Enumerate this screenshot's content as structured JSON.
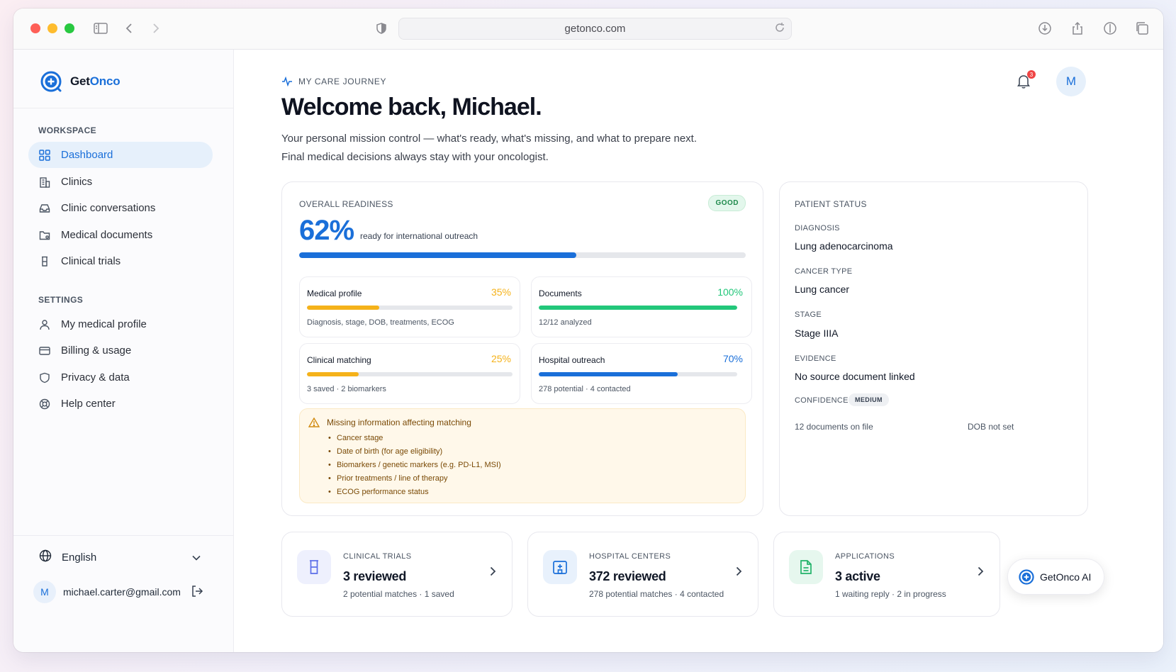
{
  "browser": {
    "url": "getonco.com"
  },
  "brand": {
    "name_part1": "Get",
    "name_part2": "Onco"
  },
  "sidebar": {
    "workspace_label": "WORKSPACE",
    "settings_label": "SETTINGS",
    "workspace_items": [
      {
        "label": "Dashboard",
        "icon": "grid-icon",
        "active": true
      },
      {
        "label": "Clinics",
        "icon": "building-icon"
      },
      {
        "label": "Clinic conversations",
        "icon": "inbox-icon"
      },
      {
        "label": "Medical documents",
        "icon": "folder-icon"
      },
      {
        "label": "Clinical trials",
        "icon": "flask-icon"
      }
    ],
    "settings_items": [
      {
        "label": "My medical profile",
        "icon": "user-icon"
      },
      {
        "label": "Billing & usage",
        "icon": "credit-card-icon"
      },
      {
        "label": "Privacy & data",
        "icon": "shield-icon"
      },
      {
        "label": "Help center",
        "icon": "lifebuoy-icon"
      }
    ],
    "language": "English",
    "user_initial": "M",
    "user_email": "michael.carter@gmail.com"
  },
  "header": {
    "eyebrow": "MY CARE JOURNEY",
    "title": "Welcome back, Michael.",
    "subtitle_line1": "Your personal mission control — what's ready, what's missing, and what to prepare next.",
    "subtitle_line2": "Final medical decisions always stay with your oncologist.",
    "notification_count": "3",
    "avatar_initial": "M"
  },
  "readiness": {
    "label": "OVERALL READINESS",
    "badge": "GOOD",
    "percent_text": "62%",
    "percent_value": 0.62,
    "description": "ready for international outreach",
    "metrics": [
      {
        "title": "Medical profile",
        "pct_text": "35%",
        "value": 0.35,
        "color": "#f5b21a",
        "desc": "Diagnosis, stage, DOB, treatments, ECOG"
      },
      {
        "title": "Documents",
        "pct_text": "100%",
        "value": 1.0,
        "color": "#22c77a",
        "desc": "12/12 analyzed"
      },
      {
        "title": "Clinical matching",
        "pct_text": "25%",
        "value": 0.25,
        "color": "#f5b21a",
        "desc": "3 saved · 2 biomarkers"
      },
      {
        "title": "Hospital outreach",
        "pct_text": "70%",
        "value": 0.7,
        "color": "#1a6fd9",
        "desc": "278 potential · 4 contacted"
      }
    ],
    "warning": {
      "title": "Missing information affecting matching",
      "items": [
        "Cancer stage",
        "Date of birth (for age eligibility)",
        "Biomarkers / genetic markers (e.g. PD-L1, MSI)",
        "Prior treatments / line of therapy",
        "ECOG performance status"
      ]
    }
  },
  "patient_status": {
    "label": "PATIENT STATUS",
    "diagnosis_label": "DIAGNOSIS",
    "diagnosis": "Lung adenocarcinoma",
    "cancer_type_label": "CANCER TYPE",
    "cancer_type": "Lung cancer",
    "stage_label": "STAGE",
    "stage": "Stage IIIA",
    "evidence_label": "EVIDENCE",
    "evidence": "No source document linked",
    "confidence_label": "CONFIDENCE",
    "confidence": "MEDIUM",
    "docs_on_file": "12 documents on file",
    "dob": "DOB not set"
  },
  "stats": [
    {
      "label": "CLINICAL TRIALS",
      "value": "3 reviewed",
      "desc": "2 potential matches · 1 saved",
      "icon": "flask-icon",
      "color": "#5b6ee8",
      "bg": "#eef0fd"
    },
    {
      "label": "HOSPITAL CENTERS",
      "value": "372 reviewed",
      "desc": "278 potential matches · 4 contacted",
      "icon": "hospital-icon",
      "color": "#1a6fd9",
      "bg": "#e8f1fc"
    },
    {
      "label": "APPLICATIONS",
      "value": "3 active",
      "desc": "1 waiting reply · 2 in progress",
      "icon": "document-icon",
      "color": "#22b36a",
      "bg": "#e6f7ee"
    }
  ],
  "assistant": {
    "label": "GetOnco AI"
  }
}
